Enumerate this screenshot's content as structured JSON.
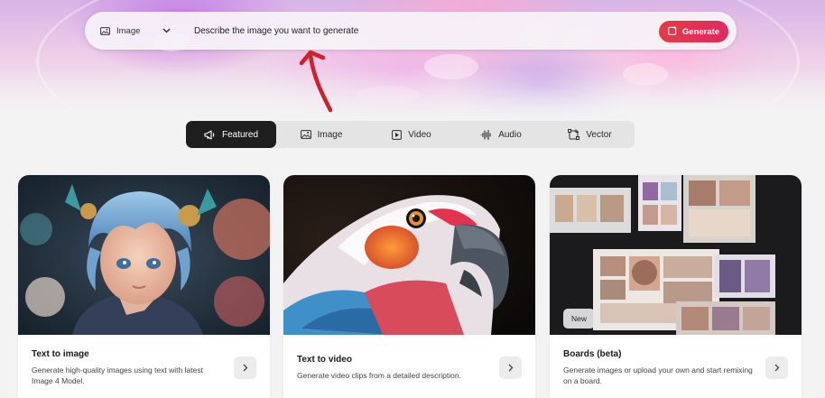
{
  "prompt_bar": {
    "mode_label": "Image",
    "mode_icon": "image-icon",
    "placeholder": "Describe the image you want to generate",
    "generate_label": "Generate",
    "generate_icon": "sparkle-edit-icon",
    "accent_color": "#e3344f"
  },
  "tabs": [
    {
      "label": "Featured",
      "icon": "megaphone-icon",
      "active": true
    },
    {
      "label": "Image",
      "icon": "image-icon",
      "active": false
    },
    {
      "label": "Video",
      "icon": "play-icon",
      "active": false
    },
    {
      "label": "Audio",
      "icon": "waveform-icon",
      "active": false
    },
    {
      "label": "Vector",
      "icon": "vector-icon",
      "active": false
    }
  ],
  "cards": [
    {
      "title": "Text to image",
      "description": "Generate high-quality images using text with latest Image 4 Model.",
      "image": "portrait-illustration"
    },
    {
      "title": "Text to video",
      "description": "Generate video clips from a detailed description.",
      "image": "parrot-closeup"
    },
    {
      "title": "Boards (beta)",
      "description": "Generate images or upload your own and start remixing on a board.",
      "badge": "New",
      "image": "moodboard-collage"
    }
  ],
  "colors": {
    "page_bg": "#f3f3f4",
    "active_tab_bg": "#1e1e1e",
    "annotation_arrow": "#d0202a"
  }
}
